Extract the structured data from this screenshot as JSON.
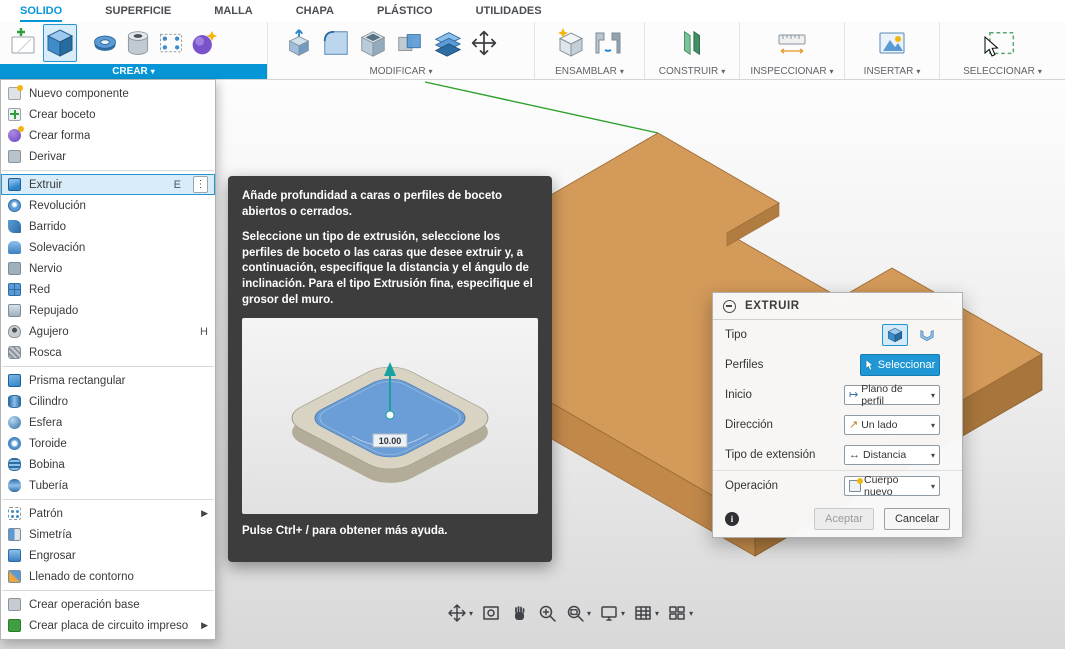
{
  "glyphs": {
    "caret": "▾",
    "submenu": "▶",
    "kebab": "⋮",
    "info": "i",
    "start": "↦",
    "direction": "↗",
    "extent": "↔"
  },
  "colors": {
    "accent": "#0696d7",
    "wood_top": "#d49a5a",
    "wood_left": "#c2884a",
    "wood_right": "#a8763c",
    "tooltip_bg": "#3d3d3d"
  },
  "tabs": {
    "items": [
      {
        "label": "SOLIDO"
      },
      {
        "label": "SUPERFICIE"
      },
      {
        "label": "MALLA"
      },
      {
        "label": "CHAPA"
      },
      {
        "label": "PLÁSTICO"
      },
      {
        "label": "UTILIDADES"
      }
    ]
  },
  "ribbon": {
    "groups": [
      {
        "label": "CREAR"
      },
      {
        "label": "MODIFICAR"
      },
      {
        "label": "ENSAMBLAR"
      },
      {
        "label": "CONSTRUIR"
      },
      {
        "label": "INSPECCIONAR"
      },
      {
        "label": "INSERTAR"
      },
      {
        "label": "SELECCIONAR"
      }
    ]
  },
  "crear_menu": {
    "items": [
      {
        "label": "Nuevo componente"
      },
      {
        "label": "Crear boceto"
      },
      {
        "label": "Crear forma"
      },
      {
        "label": "Derivar"
      },
      {
        "label": "Extruir",
        "shortcut": "E"
      },
      {
        "label": "Revolución"
      },
      {
        "label": "Barrido"
      },
      {
        "label": "Solevación"
      },
      {
        "label": "Nervio"
      },
      {
        "label": "Red"
      },
      {
        "label": "Repujado"
      },
      {
        "label": "Agujero",
        "shortcut": "H"
      },
      {
        "label": "Rosca"
      },
      {
        "label": "Prisma rectangular"
      },
      {
        "label": "Cilindro"
      },
      {
        "label": "Esfera"
      },
      {
        "label": "Toroide"
      },
      {
        "label": "Bobina"
      },
      {
        "label": "Tubería"
      },
      {
        "label": "Patrón"
      },
      {
        "label": "Simetría"
      },
      {
        "label": "Engrosar"
      },
      {
        "label": "Llenado de contorno"
      },
      {
        "label": "Crear operación base"
      },
      {
        "label": "Crear placa de circuito impreso"
      }
    ]
  },
  "tooltip": {
    "p1": "Añade profundidad a caras o perfiles de boceto abiertos o cerrados.",
    "p2": "Seleccione un tipo de extrusión, seleccione los perfiles de boceto o las caras que desee extruir y, a continuación, especifique la distancia y el ángulo de inclinación. Para el tipo Extrusión fina, especifique el grosor del muro.",
    "dim": "10.00",
    "footer": "Pulse Ctrl+ / para obtener más ayuda."
  },
  "dialog": {
    "title": "EXTRUIR",
    "labels": {
      "tipo": "Tipo",
      "perfiles": "Perfiles",
      "inicio": "Inicio",
      "direccion": "Dirección",
      "extension": "Tipo de extensión",
      "operacion": "Operación"
    },
    "values": {
      "perfiles": "Seleccionar",
      "inicio": "Plano de perfil",
      "direccion": "Un lado",
      "extension": "Distancia",
      "operacion": "Cuerpo nuevo"
    },
    "buttons": {
      "ok": "Aceptar",
      "cancel": "Cancelar"
    }
  }
}
